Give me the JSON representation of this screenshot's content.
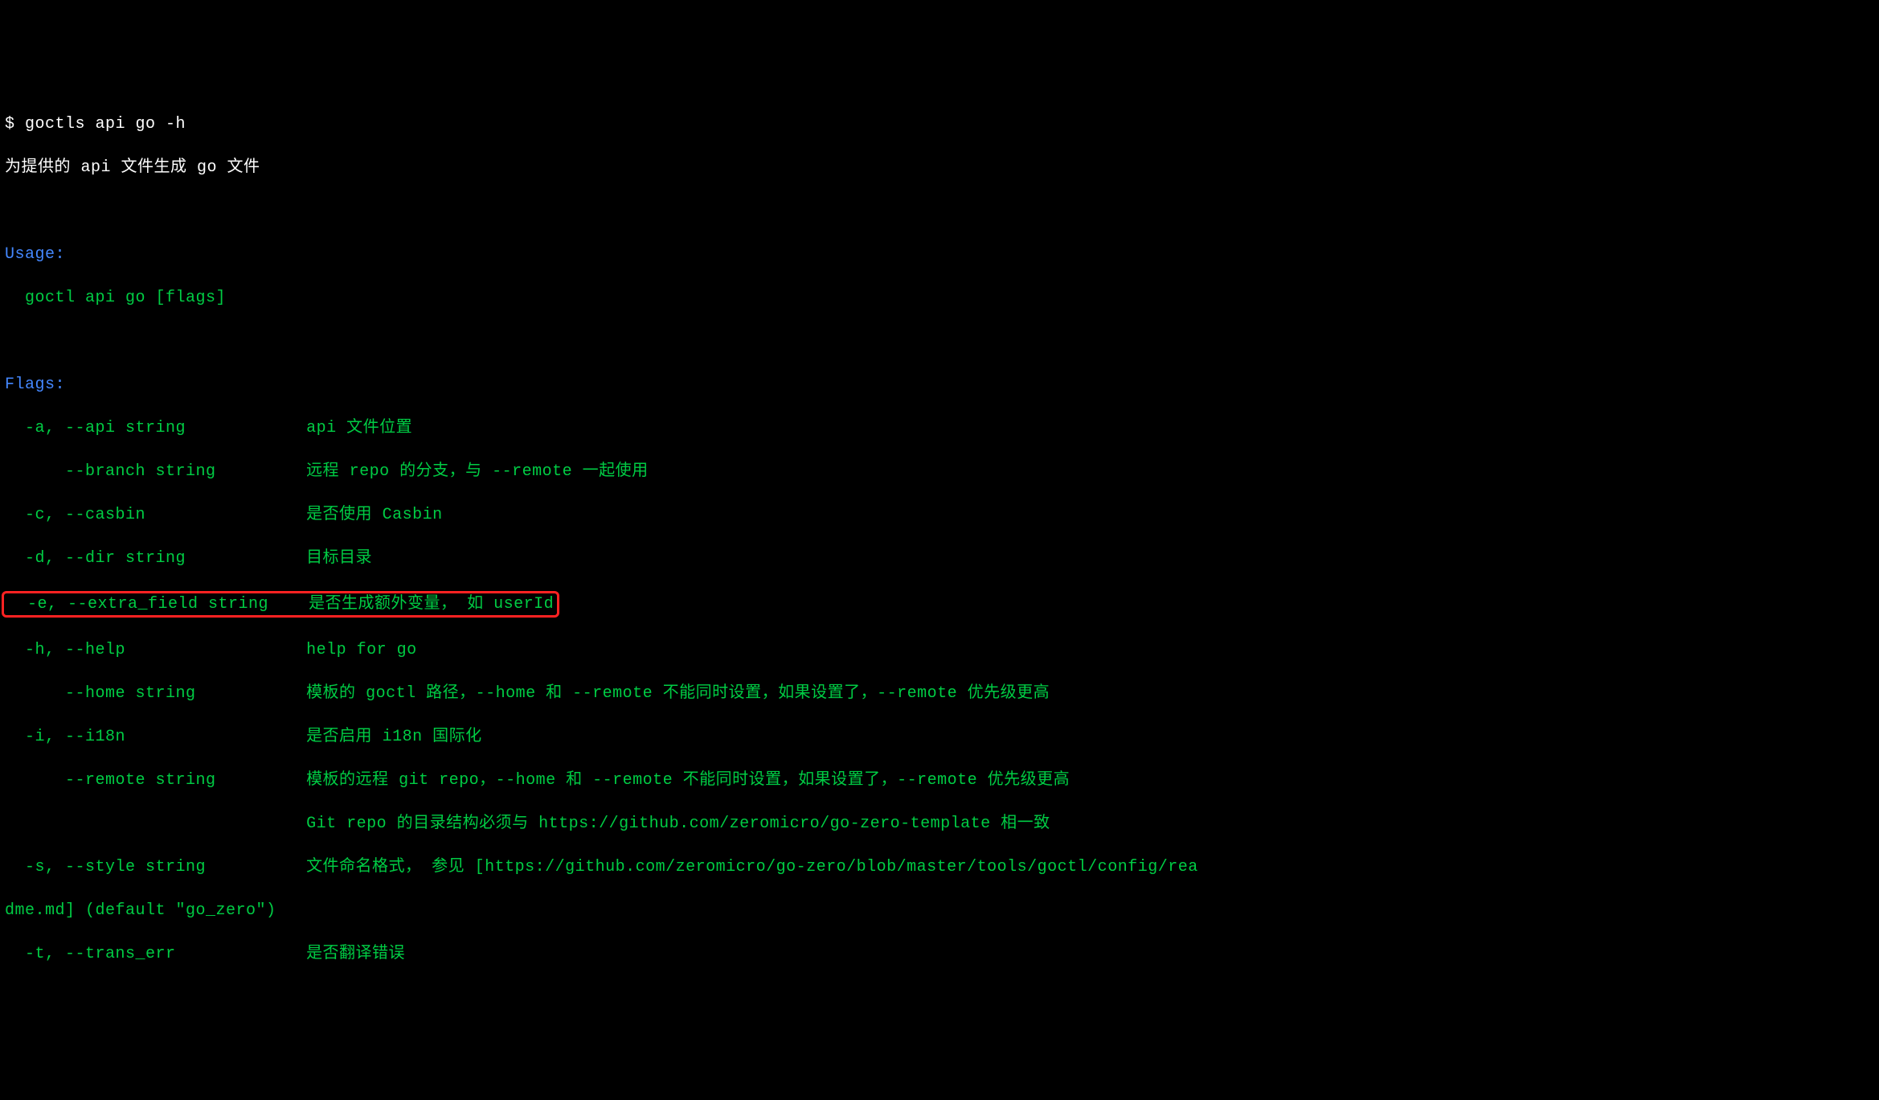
{
  "prompt": "$ ",
  "command": "goctls api go -h",
  "description": "为提供的 api 文件生成 go 文件",
  "usage_header": "Usage:",
  "usage_line": "  goctl api go [flags]",
  "flags_header": "Flags:",
  "flags": {
    "api": {
      "flag": "  -a, --api string",
      "desc": "api 文件位置"
    },
    "branch": {
      "flag": "      --branch string",
      "desc": "远程 repo 的分支，与 --remote 一起使用"
    },
    "casbin": {
      "flag": "  -c, --casbin",
      "desc": "是否使用 Casbin"
    },
    "dir": {
      "flag": "  -d, --dir string",
      "desc": "目标目录"
    },
    "extra_field": {
      "flag": "  -e, --extra_field string",
      "desc": "是否生成额外变量， 如 userId"
    },
    "help": {
      "flag": "  -h, --help",
      "desc": "help for go"
    },
    "home": {
      "flag": "      --home string",
      "desc": "模板的 goctl 路径，--home 和 --remote 不能同时设置，如果设置了，--remote 优先级更高"
    },
    "i18n": {
      "flag": "  -i, --i18n",
      "desc": "是否启用 i18n 国际化"
    },
    "remote": {
      "flag": "      --remote string",
      "desc": "模板的远程 git repo，--home 和 --remote 不能同时设置，如果设置了，--remote 优先级更高"
    },
    "remote_cont": {
      "flag": "",
      "desc": "Git repo 的目录结构必须与 https://github.com/zeromicro/go-zero-template 相一致"
    },
    "style": {
      "flag": "  -s, --style string",
      "desc": "文件命名格式， 参见 [https://github.com/zeromicro/go-zero/blob/master/tools/goctl/config/rea"
    },
    "style_cont": {
      "text": "dme.md] (default \"go_zero\")"
    },
    "trans_err": {
      "flag": "  -t, --trans_err",
      "desc": "是否翻译错误"
    }
  },
  "flag_col_width": 30
}
